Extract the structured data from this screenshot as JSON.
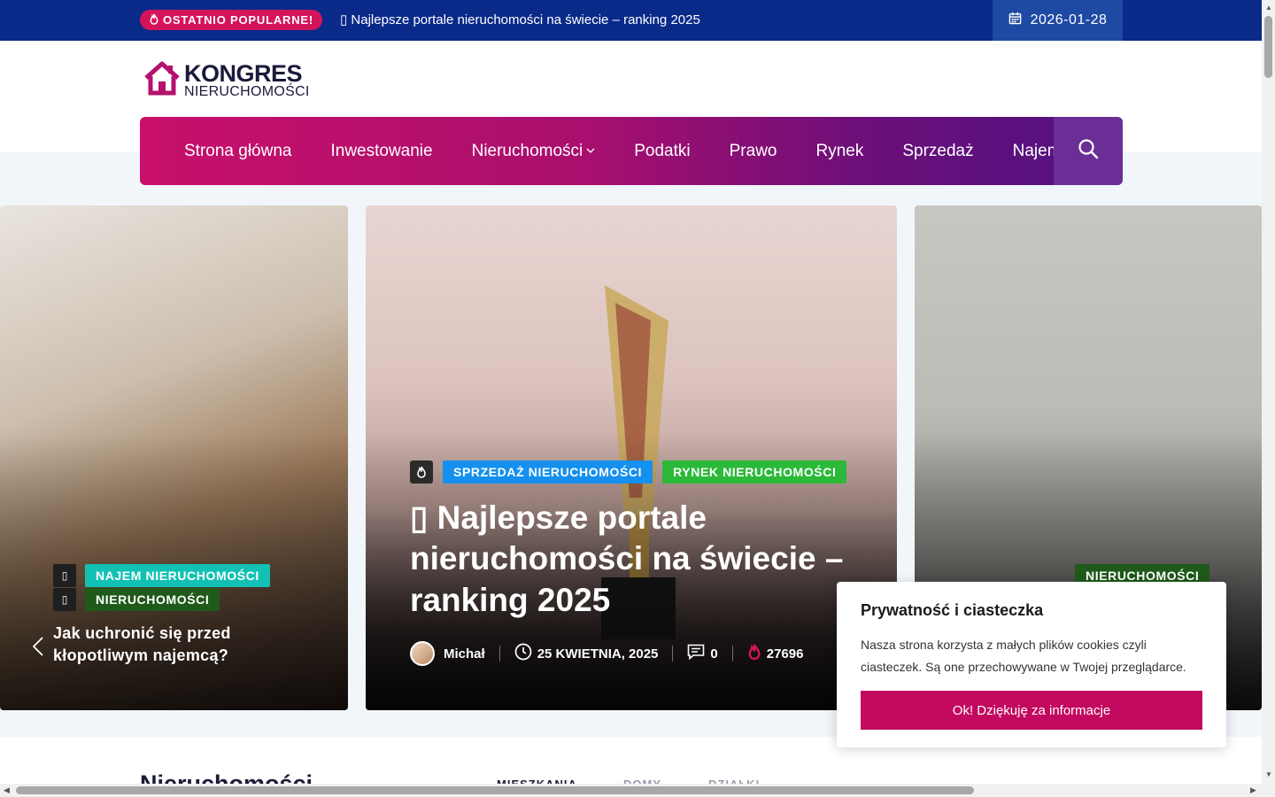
{
  "topbar": {
    "badge_label": "OSTATNIO POPULARNE!",
    "ticker_text": "▯ Najlepsze portale nieruchomości na świecie – ranking 2025",
    "date": "2026-01-28"
  },
  "logo": {
    "line1": "KONGRES",
    "line2": "NIERUCHOMOŚCI"
  },
  "nav": {
    "items": [
      "Strona główna",
      "Inwestowanie",
      "Nieruchomości",
      "Podatki",
      "Prawo",
      "Rynek",
      "Sprzedaż",
      "Najem"
    ]
  },
  "slides": {
    "left": {
      "tags": [
        "NAJEM NIERUCHOMOŚCI",
        "NIERUCHOMOŚCI"
      ],
      "title": "Jak uchronić się przed kłopotliwym najemcą?"
    },
    "center": {
      "tags": [
        "SPRZEDAŻ NIERUCHOMOŚCI",
        "RYNEK NIERUCHOMOŚCI"
      ],
      "title": "▯ Najlepsze portale nieruchomości na świecie – ranking 2025",
      "author": "Michał",
      "date": "25 KWIETNIA, 2025",
      "comments": "0",
      "views": "27696"
    },
    "right": {
      "tags": [
        "NIERUCHOMOŚCI"
      ]
    }
  },
  "section": {
    "title": "Nieruchomości",
    "tabs": [
      "MIESZKANIA",
      "DOMY",
      "DZIAŁKI"
    ]
  },
  "cookie": {
    "title": "Prywatność i ciasteczka",
    "text": "Nasza strona korzysta z małych plików cookies czyli ciasteczek. Są one przechowywane w Twojej przeglądarce.",
    "button": "Ok! Dziękuję za informacje"
  },
  "colors": {
    "topbar": "#0a2a8a",
    "accent": "#c2095f",
    "nav_start": "#c8106a",
    "nav_end": "#4f1280",
    "tag_blue": "#1590ee",
    "tag_green": "#2bb93a",
    "tag_teal": "#12c1b4"
  },
  "icons": [
    "flame-icon",
    "calendar-icon",
    "search-icon",
    "clock-icon",
    "comment-icon",
    "chevron-left-icon",
    "chevron-down-icon"
  ]
}
